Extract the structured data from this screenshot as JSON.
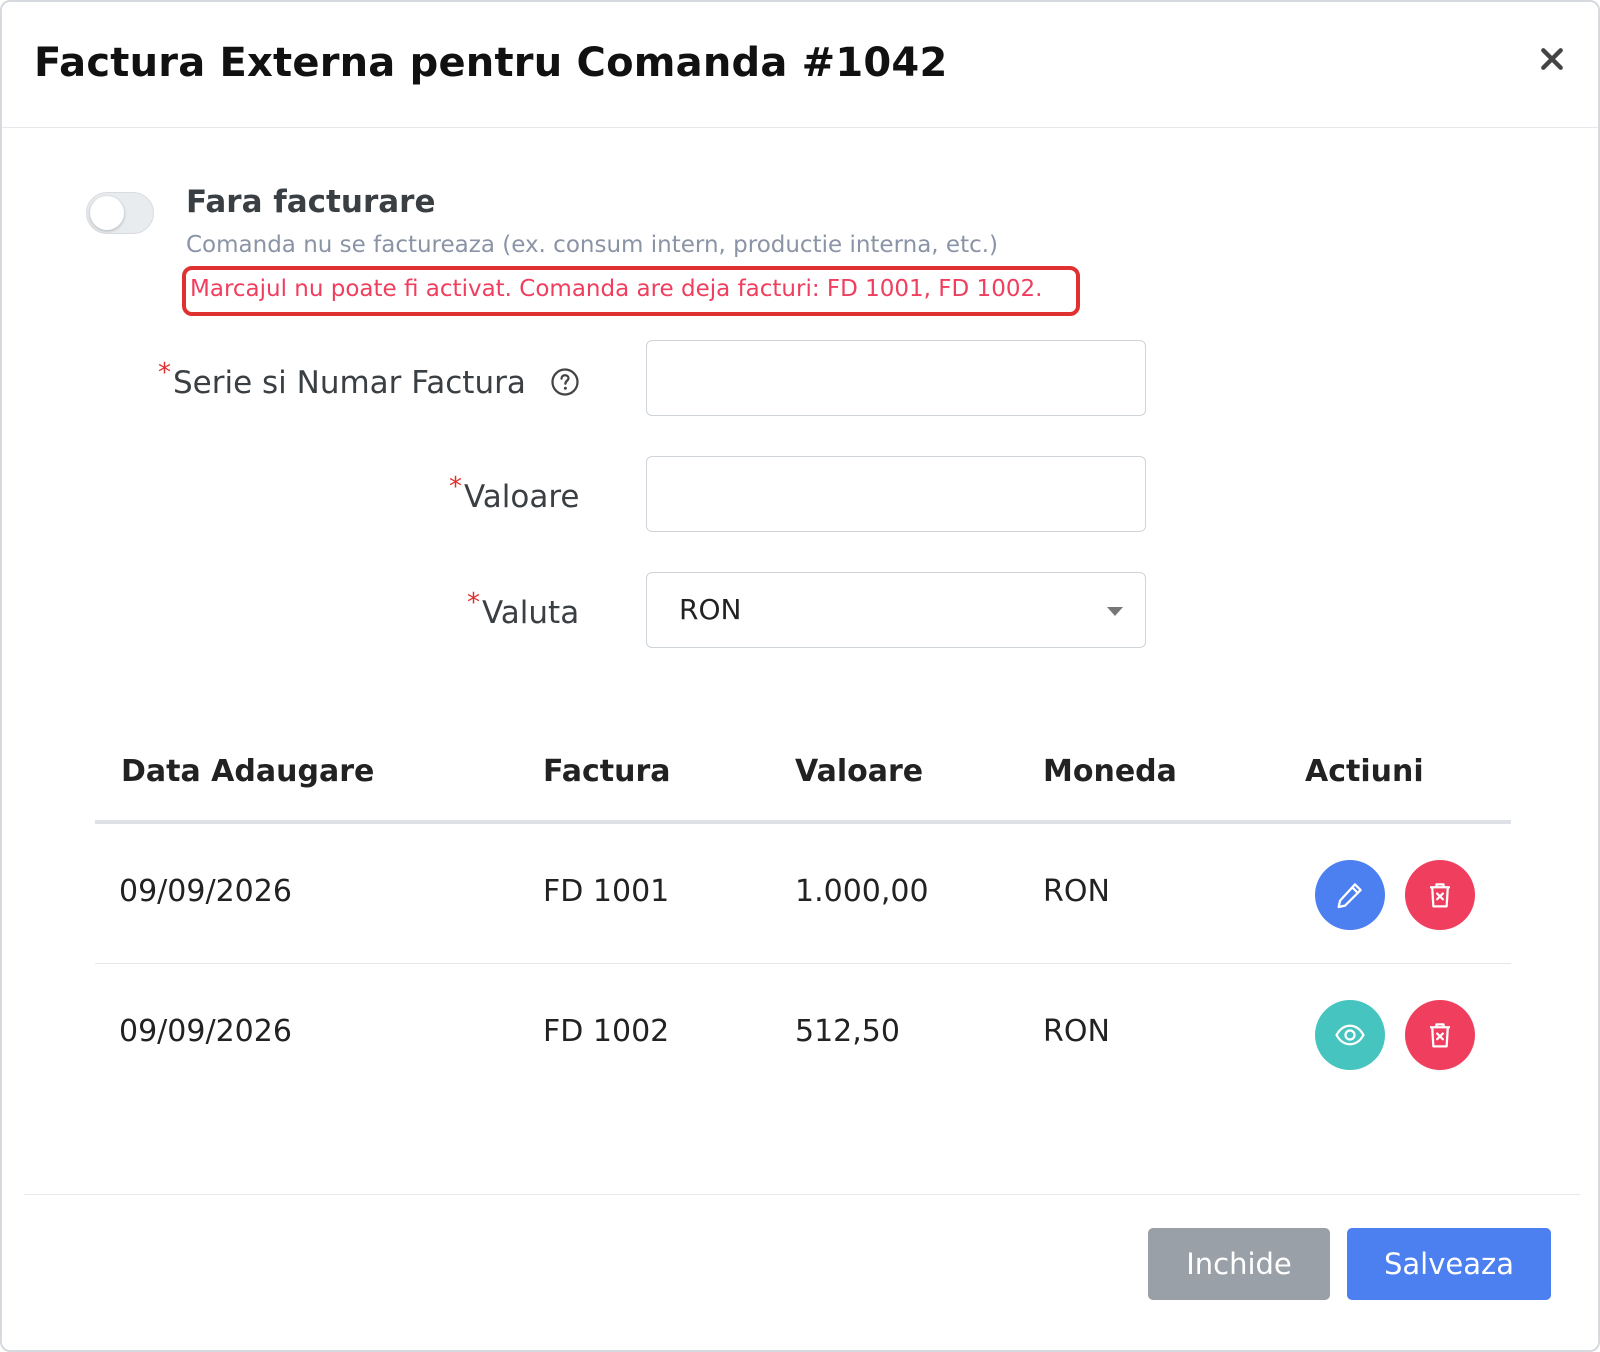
{
  "modal": {
    "title": "Factura Externa pentru Comanda #1042"
  },
  "switch": {
    "label": "Fara facturare",
    "help": "Comanda nu se factureaza (ex. consum intern, productie interna, etc.)",
    "error": "Marcajul nu poate fi activat. Comanda are deja facturi: FD 1001, FD 1002.",
    "checked": false
  },
  "form": {
    "required_mark": "*",
    "invoice_label": "Serie si Numar Factura",
    "invoice_value": "",
    "value_label": "Valoare",
    "value_value": "",
    "currency_label": "Valuta",
    "currency_selected": "RON"
  },
  "table": {
    "headers": [
      "Data Adaugare",
      "Factura",
      "Valoare",
      "Moneda",
      "Actiuni"
    ],
    "rows": [
      {
        "date": "09/09/2026",
        "invoice": "FD 1001",
        "value": "1.000,00",
        "currency": "RON",
        "primary_action": "edit-icon",
        "secondary_action": "trash-icon"
      },
      {
        "date": "09/09/2026",
        "invoice": "FD 1002",
        "value": "512,50",
        "currency": "RON",
        "primary_action": "eye-icon",
        "secondary_action": "trash-icon"
      }
    ]
  },
  "footer": {
    "close_label": "Inchide",
    "save_label": "Salveaza"
  },
  "colors": {
    "primary": "#4c7ff0",
    "danger": "#f03e5e",
    "info": "#45c4c0",
    "secondary": "#9aa0a8",
    "error_border": "#e03131"
  }
}
